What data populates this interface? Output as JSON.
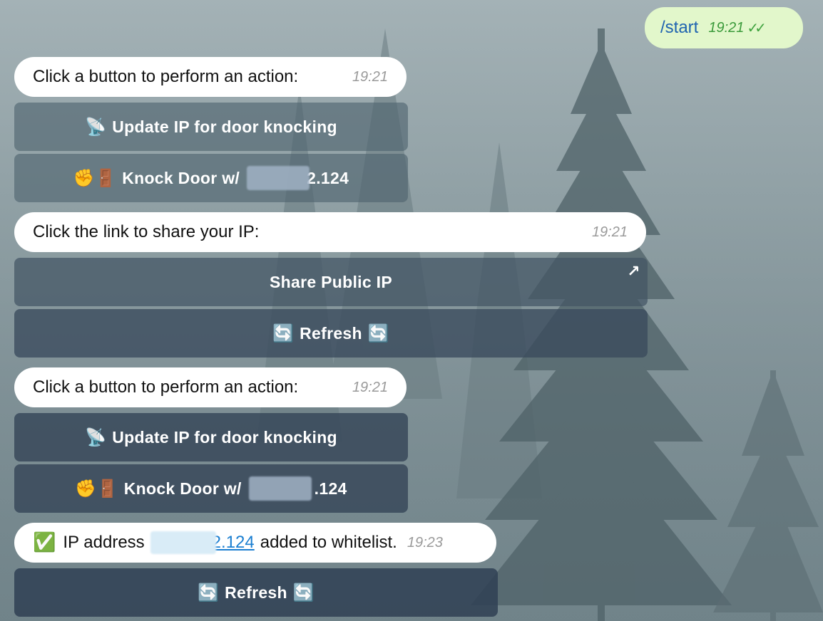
{
  "outgoing": {
    "text": "/start",
    "time": "19:21",
    "status_icon": "double-check-icon"
  },
  "messages": [
    {
      "text": "Click a button to perform an action:",
      "time": "19:21",
      "buttons": [
        {
          "emoji": "📡",
          "label": "Update IP for door knocking"
        },
        {
          "emoji": "✊🚪",
          "label_prefix": "Knock Door w/",
          "label_suffix": "2.124"
        }
      ]
    },
    {
      "text": "Click the link to share your IP:",
      "time": "19:21",
      "buttons": [
        {
          "label": "Share Public IP",
          "icon": "external-link-arrow-icon"
        },
        {
          "emoji": "🔄",
          "label": "Refresh"
        }
      ]
    },
    {
      "text": "Click a button to perform an action:",
      "time": "19:21",
      "buttons": [
        {
          "emoji": "📡",
          "label": "Update IP for door knocking"
        },
        {
          "emoji": "✊🚪",
          "label_prefix": "Knock Door w/",
          "label_suffix": ".124"
        }
      ]
    },
    {
      "emoji": "✅",
      "text_prefix": "IP address",
      "link_suffix": "2.124",
      "text_suffix": "added to whitelist.",
      "time": "19:23",
      "buttons": [
        {
          "emoji": "🔄",
          "label": "Refresh"
        }
      ]
    }
  ],
  "colors": {
    "outgoing_bubble": "#e2f7cb",
    "incoming_bubble": "#ffffff",
    "link": "#1b7fd1",
    "read_check": "#3fa33f"
  }
}
